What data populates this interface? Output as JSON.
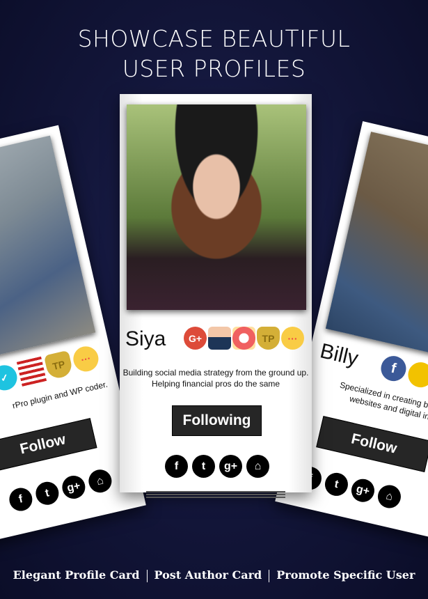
{
  "headline": [
    "SHOWCASE BEAUTIFUL",
    "USER PROFILES"
  ],
  "cards": {
    "left": {
      "bio": "rPro plugin and WP coder.",
      "button": "Follow",
      "badges": [
        "verified-icon",
        "us-flag-icon",
        "tp-shield-icon",
        "chat-bubble-icon"
      ]
    },
    "center": {
      "name": "Siya",
      "bio": [
        "Building social media strategy from the ground up.",
        "Helping financial pros do the same"
      ],
      "button": "Following",
      "badges": [
        "google-plus-icon",
        "businessman-icon",
        "lifebuoy-icon",
        "tp-shield-icon",
        "chat-bubble-icon"
      ]
    },
    "right": {
      "name": "Billy",
      "bio": [
        "Specialized in creating beaut",
        "websites and digital in"
      ],
      "button": "Follow",
      "badges": [
        "facebook-icon",
        "medal-icon"
      ]
    }
  },
  "social_icons": [
    "facebook",
    "twitter",
    "google-plus",
    "home"
  ],
  "social_glyphs": {
    "facebook": "f",
    "twitter": "t",
    "google-plus": "g+",
    "home": "⌂",
    "gplus_badge": "G+",
    "tp": "TP",
    "chat": "···",
    "check": "✓"
  },
  "footer": [
    "Elegant Profile Card",
    "Post Author Card",
    "Promote Specific User"
  ],
  "colors": {
    "background": "#121538",
    "button": "#262626",
    "google": "#dd4b39",
    "facebook": "#3b5998",
    "gold": "#d4af37",
    "chat": "#f9cc45",
    "verified": "#1ec3e0"
  }
}
